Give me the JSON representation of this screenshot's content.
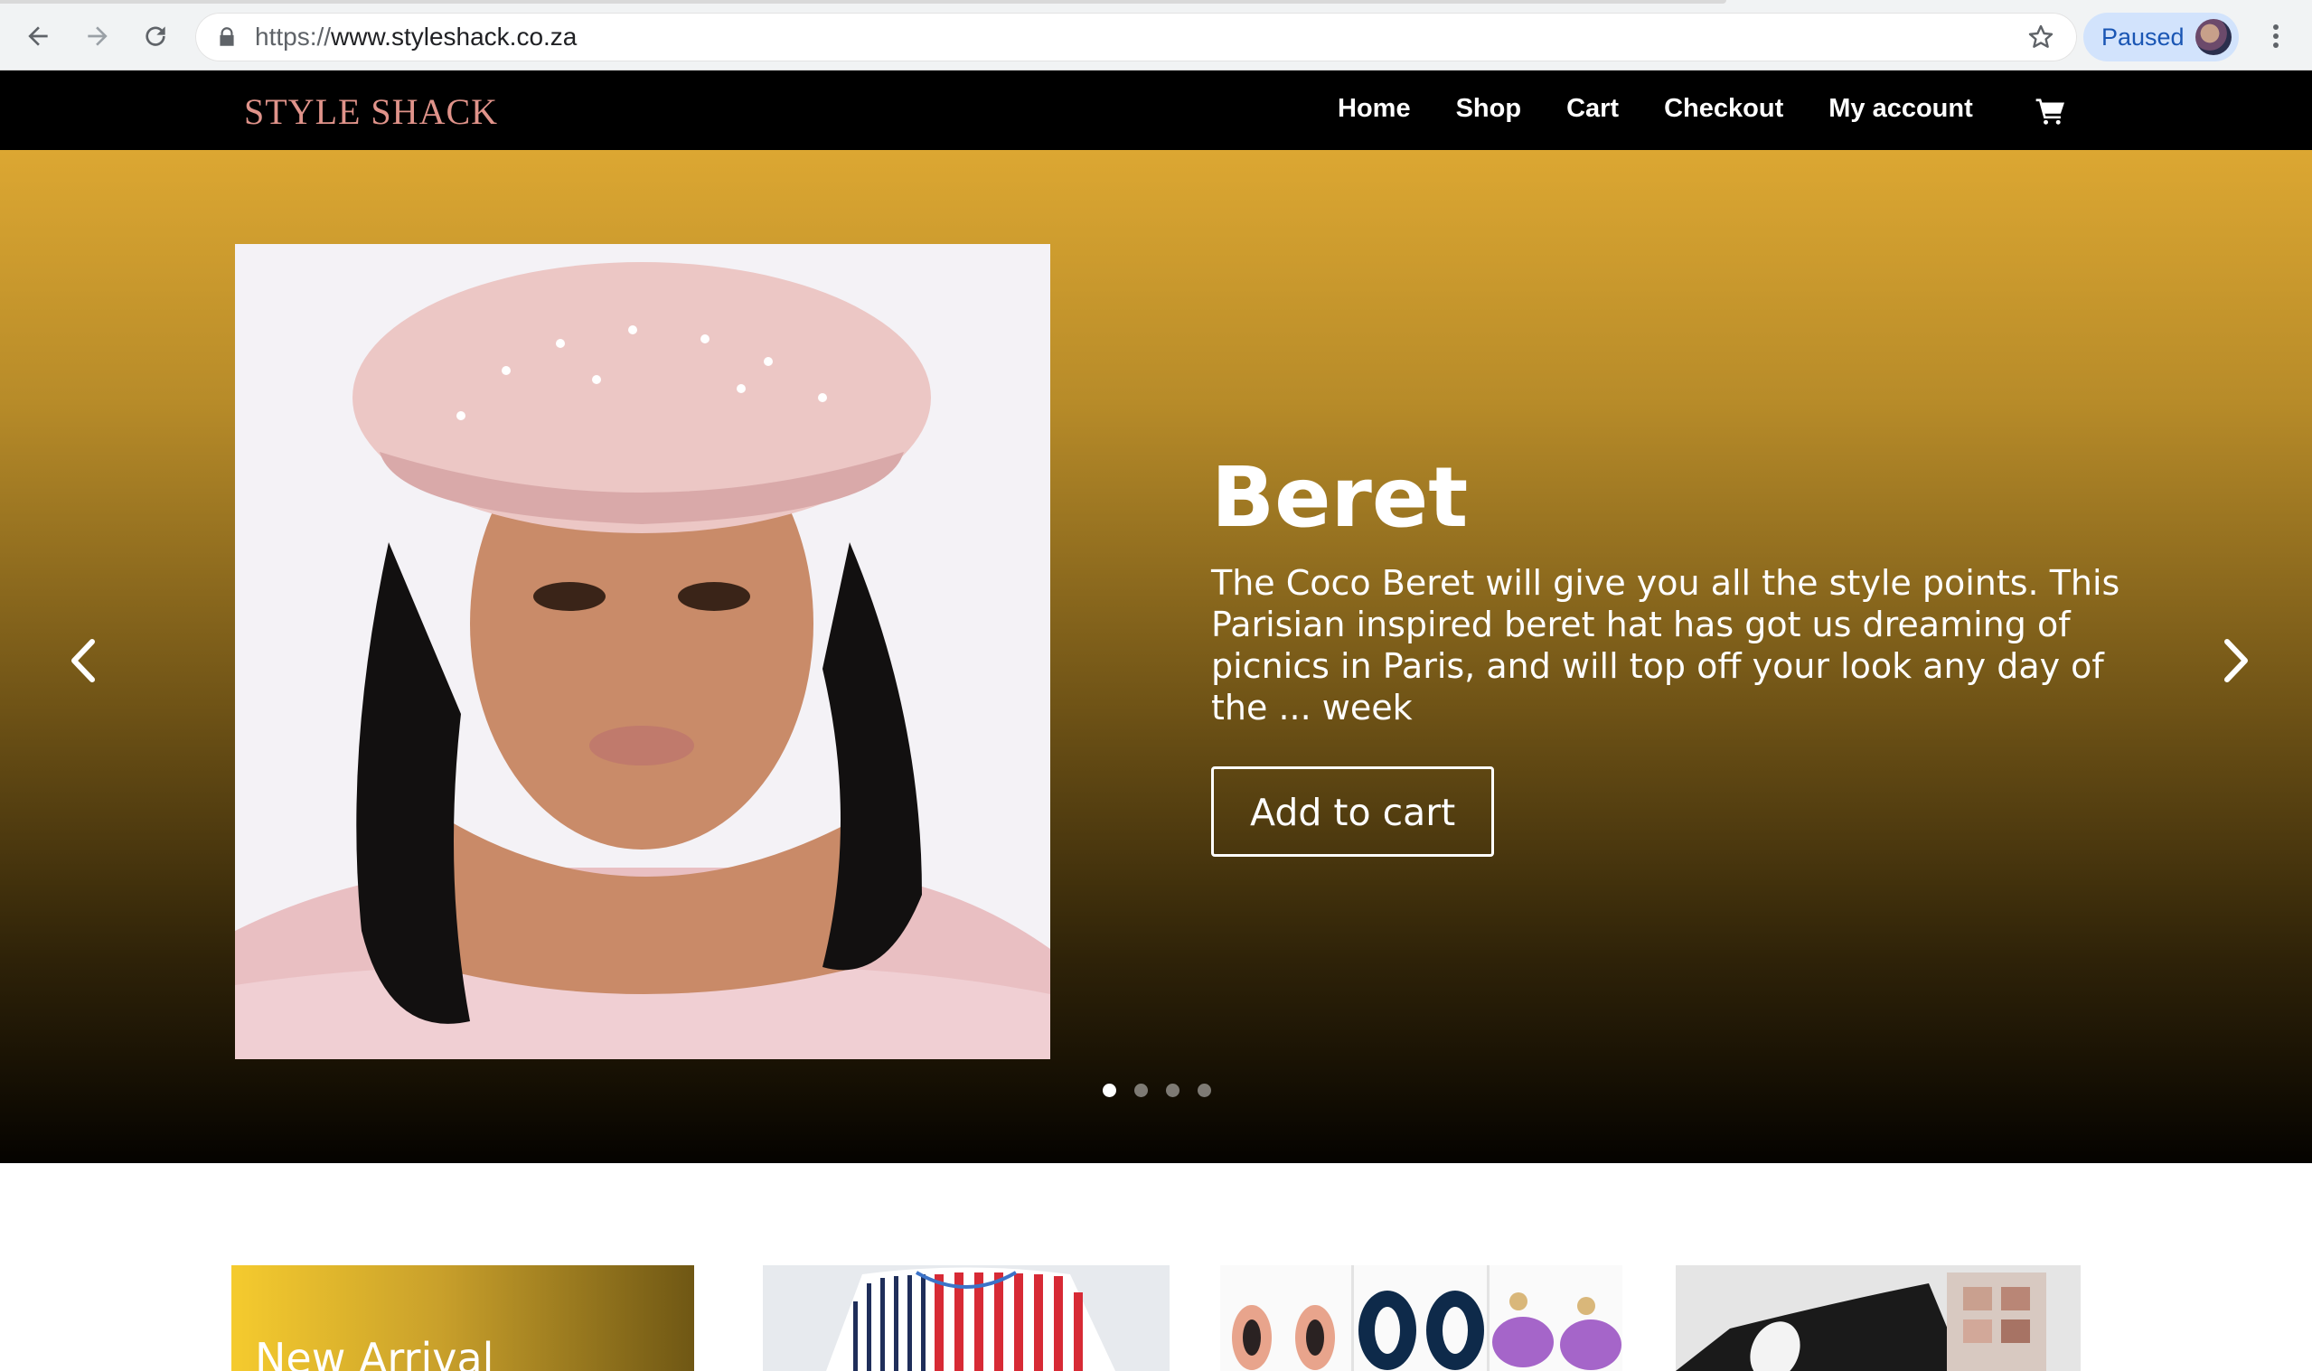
{
  "browser": {
    "url_scheme": "https://",
    "url_host": "www.styleshack.co.za",
    "profile_status": "Paused"
  },
  "site": {
    "logo": "STYLE SHACK",
    "nav": [
      "Home",
      "Shop",
      "Cart",
      "Checkout",
      "My account"
    ]
  },
  "hero": {
    "title": "Beret",
    "description": "The Coco Beret will give you all the style points. This Parisian inspired beret hat has got us dreaming of picnics in Paris, and will top off your look any day of the ... week",
    "button": "Add to cart",
    "slide_count": 4,
    "active_slide": 1
  },
  "cards": {
    "first_label": "New Arrival"
  },
  "colors": {
    "header_bg": "#000000",
    "logo": "#e0938a",
    "hero_top": "#dca732",
    "hero_bottom": "#050300",
    "profile_chip": "#d2e3fc"
  },
  "icons": [
    "back-icon",
    "forward-icon",
    "reload-icon",
    "lock-icon",
    "star-icon",
    "menu-kebab-icon",
    "cart-icon",
    "chevron-left-icon",
    "chevron-right-icon"
  ]
}
